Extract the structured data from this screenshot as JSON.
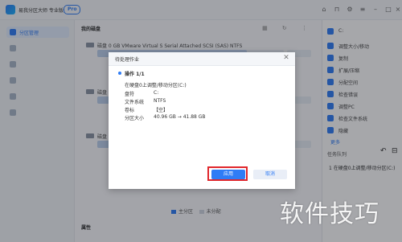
{
  "titlebar": {
    "app_title": "易我分区大师 专业版",
    "badge": "Pro"
  },
  "sidebar": {
    "items": [
      {
        "label": "分区管理"
      },
      {
        "label": ""
      },
      {
        "label": ""
      },
      {
        "label": ""
      },
      {
        "label": ""
      },
      {
        "label": ""
      }
    ]
  },
  "main": {
    "title": "我的磁盘",
    "disk0": {
      "name": "磁盘 0  GB    VMware Virtual S   Serial Attached   SCSI (SAS)   NTFS"
    },
    "disk1": {
      "name": "磁盘"
    },
    "disk2": {
      "name": "磁盘"
    },
    "legend": {
      "primary": "主分区",
      "unallocated": "未分配"
    },
    "properties": "属性"
  },
  "right_panel": {
    "header": "C:",
    "items": [
      {
        "label": "调整大小/移动"
      },
      {
        "label": "复制"
      },
      {
        "label": "扩展/压缩"
      },
      {
        "label": "分配空间"
      },
      {
        "label": "检查错误"
      },
      {
        "label": "调整PC"
      },
      {
        "label": "检查文件系统"
      },
      {
        "label": "隐藏"
      }
    ],
    "more": "更多",
    "queue_title": "任务队列",
    "queue_item": "1  在硬盘0上调整/移动分区(C:)"
  },
  "dialog": {
    "title": "待处理作业",
    "op_label": "操作 1/1",
    "op_desc": "在硬盘0上调整/移动分区(C:)",
    "rows": [
      {
        "key": "盘符",
        "value": "C:"
      },
      {
        "key": "文件系统",
        "value": "NTFS"
      },
      {
        "key": "卷标",
        "value": "【空】"
      },
      {
        "key": "分区大小",
        "value": "40.96 GB → 41.88 GB"
      }
    ],
    "apply": "应用",
    "cancel": "取消"
  },
  "watermark": "软件技巧",
  "colors": {
    "accent": "#2f7cf6",
    "highlight": "#e0262b"
  }
}
